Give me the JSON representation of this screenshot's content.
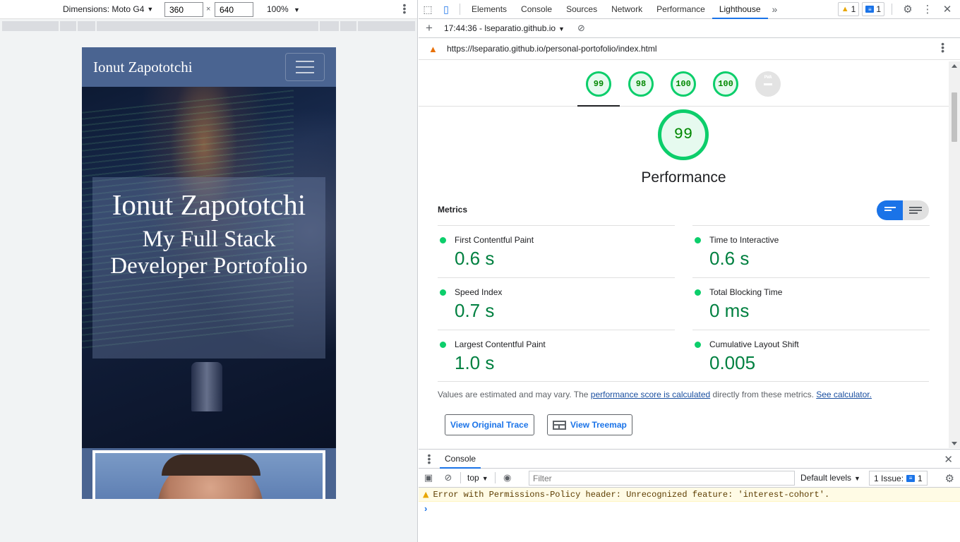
{
  "device_toolbar": {
    "dimensions_label": "Dimensions: Moto G4",
    "width": "360",
    "height": "640",
    "zoom": "100%",
    "times": "×"
  },
  "site": {
    "brand": "Ionut Zapototchi",
    "hero_name": "Ionut Zapototchi",
    "hero_subtitle": "My Full Stack Developer Portofolio",
    "nav_bg": "#4a6491"
  },
  "devtools": {
    "tabs": [
      "Elements",
      "Console",
      "Sources",
      "Network",
      "Performance",
      "Lighthouse"
    ],
    "active_tab": "Lighthouse",
    "warnings_count": "1",
    "messages_count": "1"
  },
  "lighthouse_bar": {
    "report_label": "17:44:36 - lseparatio.github.io"
  },
  "url_bar": {
    "url": "https://lseparatio.github.io/personal-portofolio/index.html"
  },
  "scores": {
    "mini": [
      "99",
      "98",
      "100",
      "100"
    ],
    "pwa_label": "PWA",
    "main_score": "99",
    "category": "Performance"
  },
  "metrics": {
    "heading": "Metrics",
    "items": [
      {
        "label": "First Contentful Paint",
        "value": "0.6 s"
      },
      {
        "label": "Time to Interactive",
        "value": "0.6 s"
      },
      {
        "label": "Speed Index",
        "value": "0.7 s"
      },
      {
        "label": "Total Blocking Time",
        "value": "0 ms"
      },
      {
        "label": "Largest Contentful Paint",
        "value": "1.0 s"
      },
      {
        "label": "Cumulative Layout Shift",
        "value": "0.005"
      }
    ],
    "note_prefix": "Values are estimated and may vary. The ",
    "note_link": "performance score is calculated",
    "note_middle": " directly from these metrics. ",
    "note_link2": "See calculator.",
    "btn_trace": "View Original Trace",
    "btn_treemap": "View Treemap",
    "pass_color": "#0cce6b"
  },
  "console": {
    "tab": "Console",
    "context": "top",
    "filter_placeholder": "Filter",
    "levels": "Default levels",
    "issues_label": "1 Issue:",
    "issues_count": "1",
    "warning": "Error with Permissions-Policy header: Unrecognized feature: 'interest-cohort'.",
    "prompt": "›"
  }
}
